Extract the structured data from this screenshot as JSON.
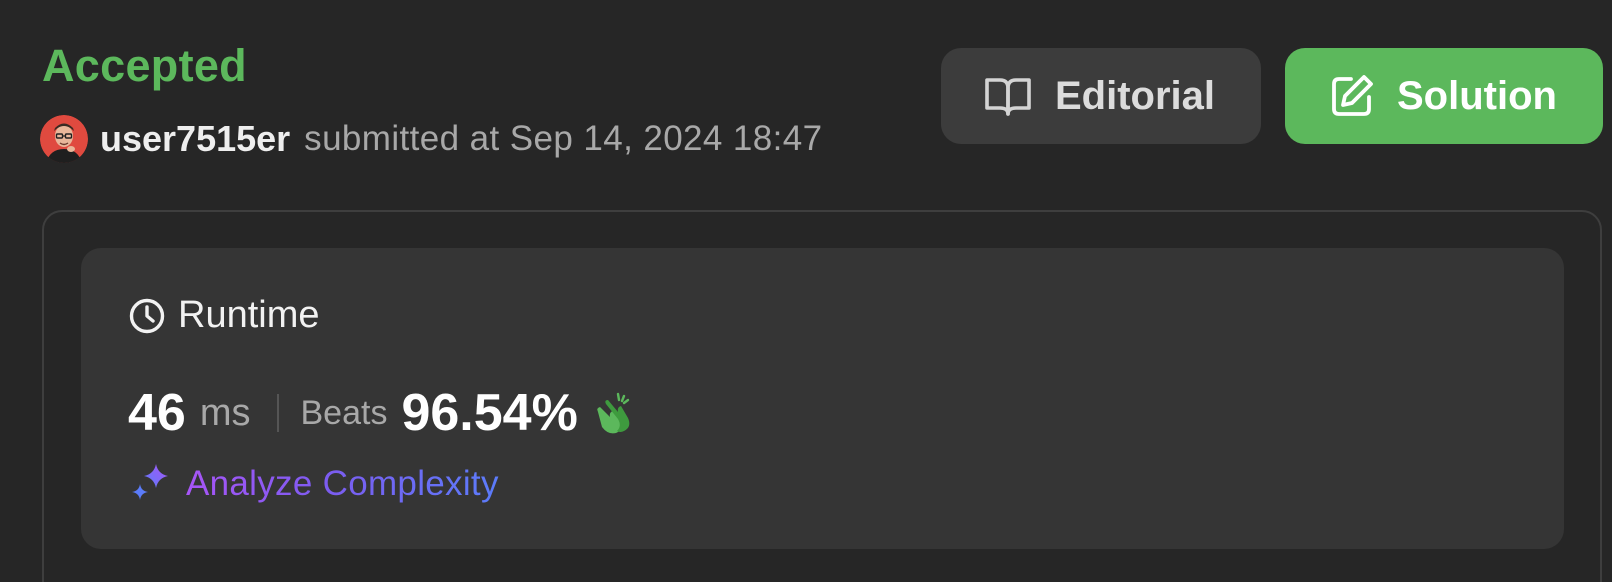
{
  "status": {
    "label": "Accepted",
    "color": "#5cb85c"
  },
  "submission": {
    "username": "user7515er",
    "submitted_text": "submitted at Sep 14, 2024 18:47",
    "avatar_icon": "user-avatar-photo"
  },
  "actions": {
    "editorial": {
      "label": "Editorial",
      "icon": "book-open-icon"
    },
    "solution": {
      "label": "Solution",
      "icon": "edit-pencil-icon",
      "color": "#5cb85c"
    }
  },
  "runtime": {
    "title": "Runtime",
    "icon": "clock-icon",
    "value": "46",
    "unit": "ms",
    "beats_label": "Beats",
    "beats_value": "96.54%",
    "celebrate_icon": "clapping-hands-icon"
  },
  "analyze": {
    "label": "Analyze Complexity",
    "icon": "sparkles-icon"
  }
}
